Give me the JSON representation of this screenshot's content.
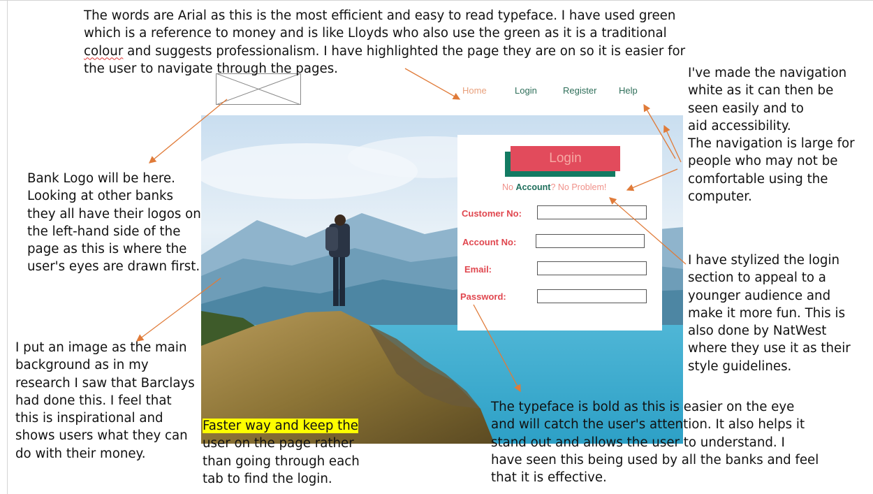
{
  "notes": {
    "typeface": [
      {
        "pre": "The words are Arial as this is the most efficient and easy to read typeface. I have used green",
        "sq": "",
        "post": ""
      },
      {
        "pre": "which is a reference to money and is like Lloyds who also use the green as it is a traditional",
        "sq": "",
        "post": ""
      },
      {
        "pre": "",
        "sq": "colour",
        "post": " and suggests professionalism. I have highlighted the page they are on so it is easier for"
      },
      {
        "pre": "the user to navigate through the pages.",
        "sq": "",
        "post": ""
      }
    ],
    "navigation": [
      "I've made the navigation",
      "white as it can then be",
      "seen easily and to",
      "aid accessibility.",
      "The navigation is large for",
      "people who may not be",
      "comfortable using the",
      "computer."
    ],
    "logo": [
      "Bank Logo will be here.",
      "Looking at other banks",
      "they all have their logos on",
      "the left-hand side of the",
      "page as this is where the",
      "user's eyes are drawn first."
    ],
    "login_style": [
      "I have stylized the login",
      "section to appeal to a",
      "younger audience and",
      "make it more fun. This is",
      "also done by NatWest",
      "where they use it as their",
      "style guidelines."
    ],
    "background": [
      "I put an image as the main",
      "background as in my",
      "research I saw that Barclays",
      "had done this. I feel that",
      "this is inspirational and",
      "shows users what they can",
      "do with their money."
    ],
    "faster": {
      "highlight": "Faster way and keep the",
      "lines": [
        "user on the page rather",
        "than going through each",
        "tab to find the login."
      ]
    },
    "bold": [
      "The typeface is bold as this is easier on the eye",
      "and will catch the user's attention. It also helps it",
      "stand out and allows the user to understand. I",
      "have seen this being used by all the banks and feel",
      "that it is effective."
    ]
  },
  "nav": {
    "items": [
      "Home",
      "Login",
      "Register",
      "Help"
    ],
    "active": "Home"
  },
  "login": {
    "button": "Login",
    "no_account": {
      "pre": "No ",
      "bold": "Account",
      "post": "? No Problem!"
    },
    "fields": [
      "Customer No:",
      "Account No:",
      "Email:",
      "Password:"
    ]
  },
  "colors": {
    "accent_green": "#137a62",
    "login_red": "#e24b5c",
    "arrow": "#e07b39",
    "highlight": "#ffff00"
  }
}
